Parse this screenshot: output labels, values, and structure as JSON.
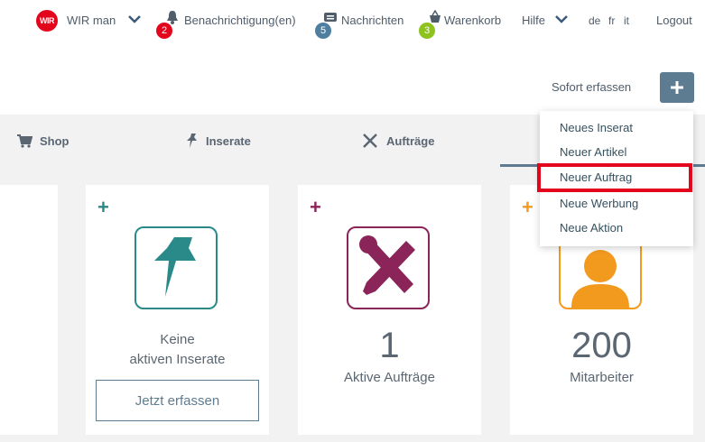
{
  "topbar": {
    "logo_text": "WIR",
    "user_name": "WIR man",
    "notifications_label": "Benachrichtigung(en)",
    "notifications_count": "2",
    "messages_label": "Nachrichten",
    "messages_count": "5",
    "cart_label": "Warenkorb",
    "cart_count": "3",
    "help_label": "Hilfe",
    "languages": [
      "de",
      "fr",
      "it"
    ],
    "logout_label": "Logout"
  },
  "quick_add": {
    "label": "Sofort erfassen",
    "button_icon": "plus-icon"
  },
  "tabs": [
    {
      "label": "Shop",
      "icon": "cart-icon"
    },
    {
      "label": "Inserate",
      "icon": "pin-icon"
    },
    {
      "label": "Aufträge",
      "icon": "tools-icon"
    }
  ],
  "dropdown": {
    "items": [
      "Neues Inserat",
      "Neuer Artikel",
      "Neuer Auftrag",
      "Neue Werbung",
      "Neue Aktion"
    ],
    "highlighted_index": 2
  },
  "cards": [
    {
      "name": "inserate",
      "label_line1": "Keine",
      "label_line2": "aktiven Inserate",
      "cta": "Jetzt erfassen",
      "accent": "#2a8a8a"
    },
    {
      "name": "auftraege",
      "value": "1",
      "label": "Aktive Aufträge",
      "accent": "#8b2459"
    },
    {
      "name": "mitarbeiter",
      "value": "200",
      "label": "Mitarbeiter",
      "accent": "#f29a1e"
    }
  ],
  "colors": {
    "brand_red": "#e3051b",
    "primary": "#5d7b91",
    "badge_red": "#e3051b",
    "badge_blue": "#4f7fa0",
    "badge_green": "#8dc21f"
  }
}
